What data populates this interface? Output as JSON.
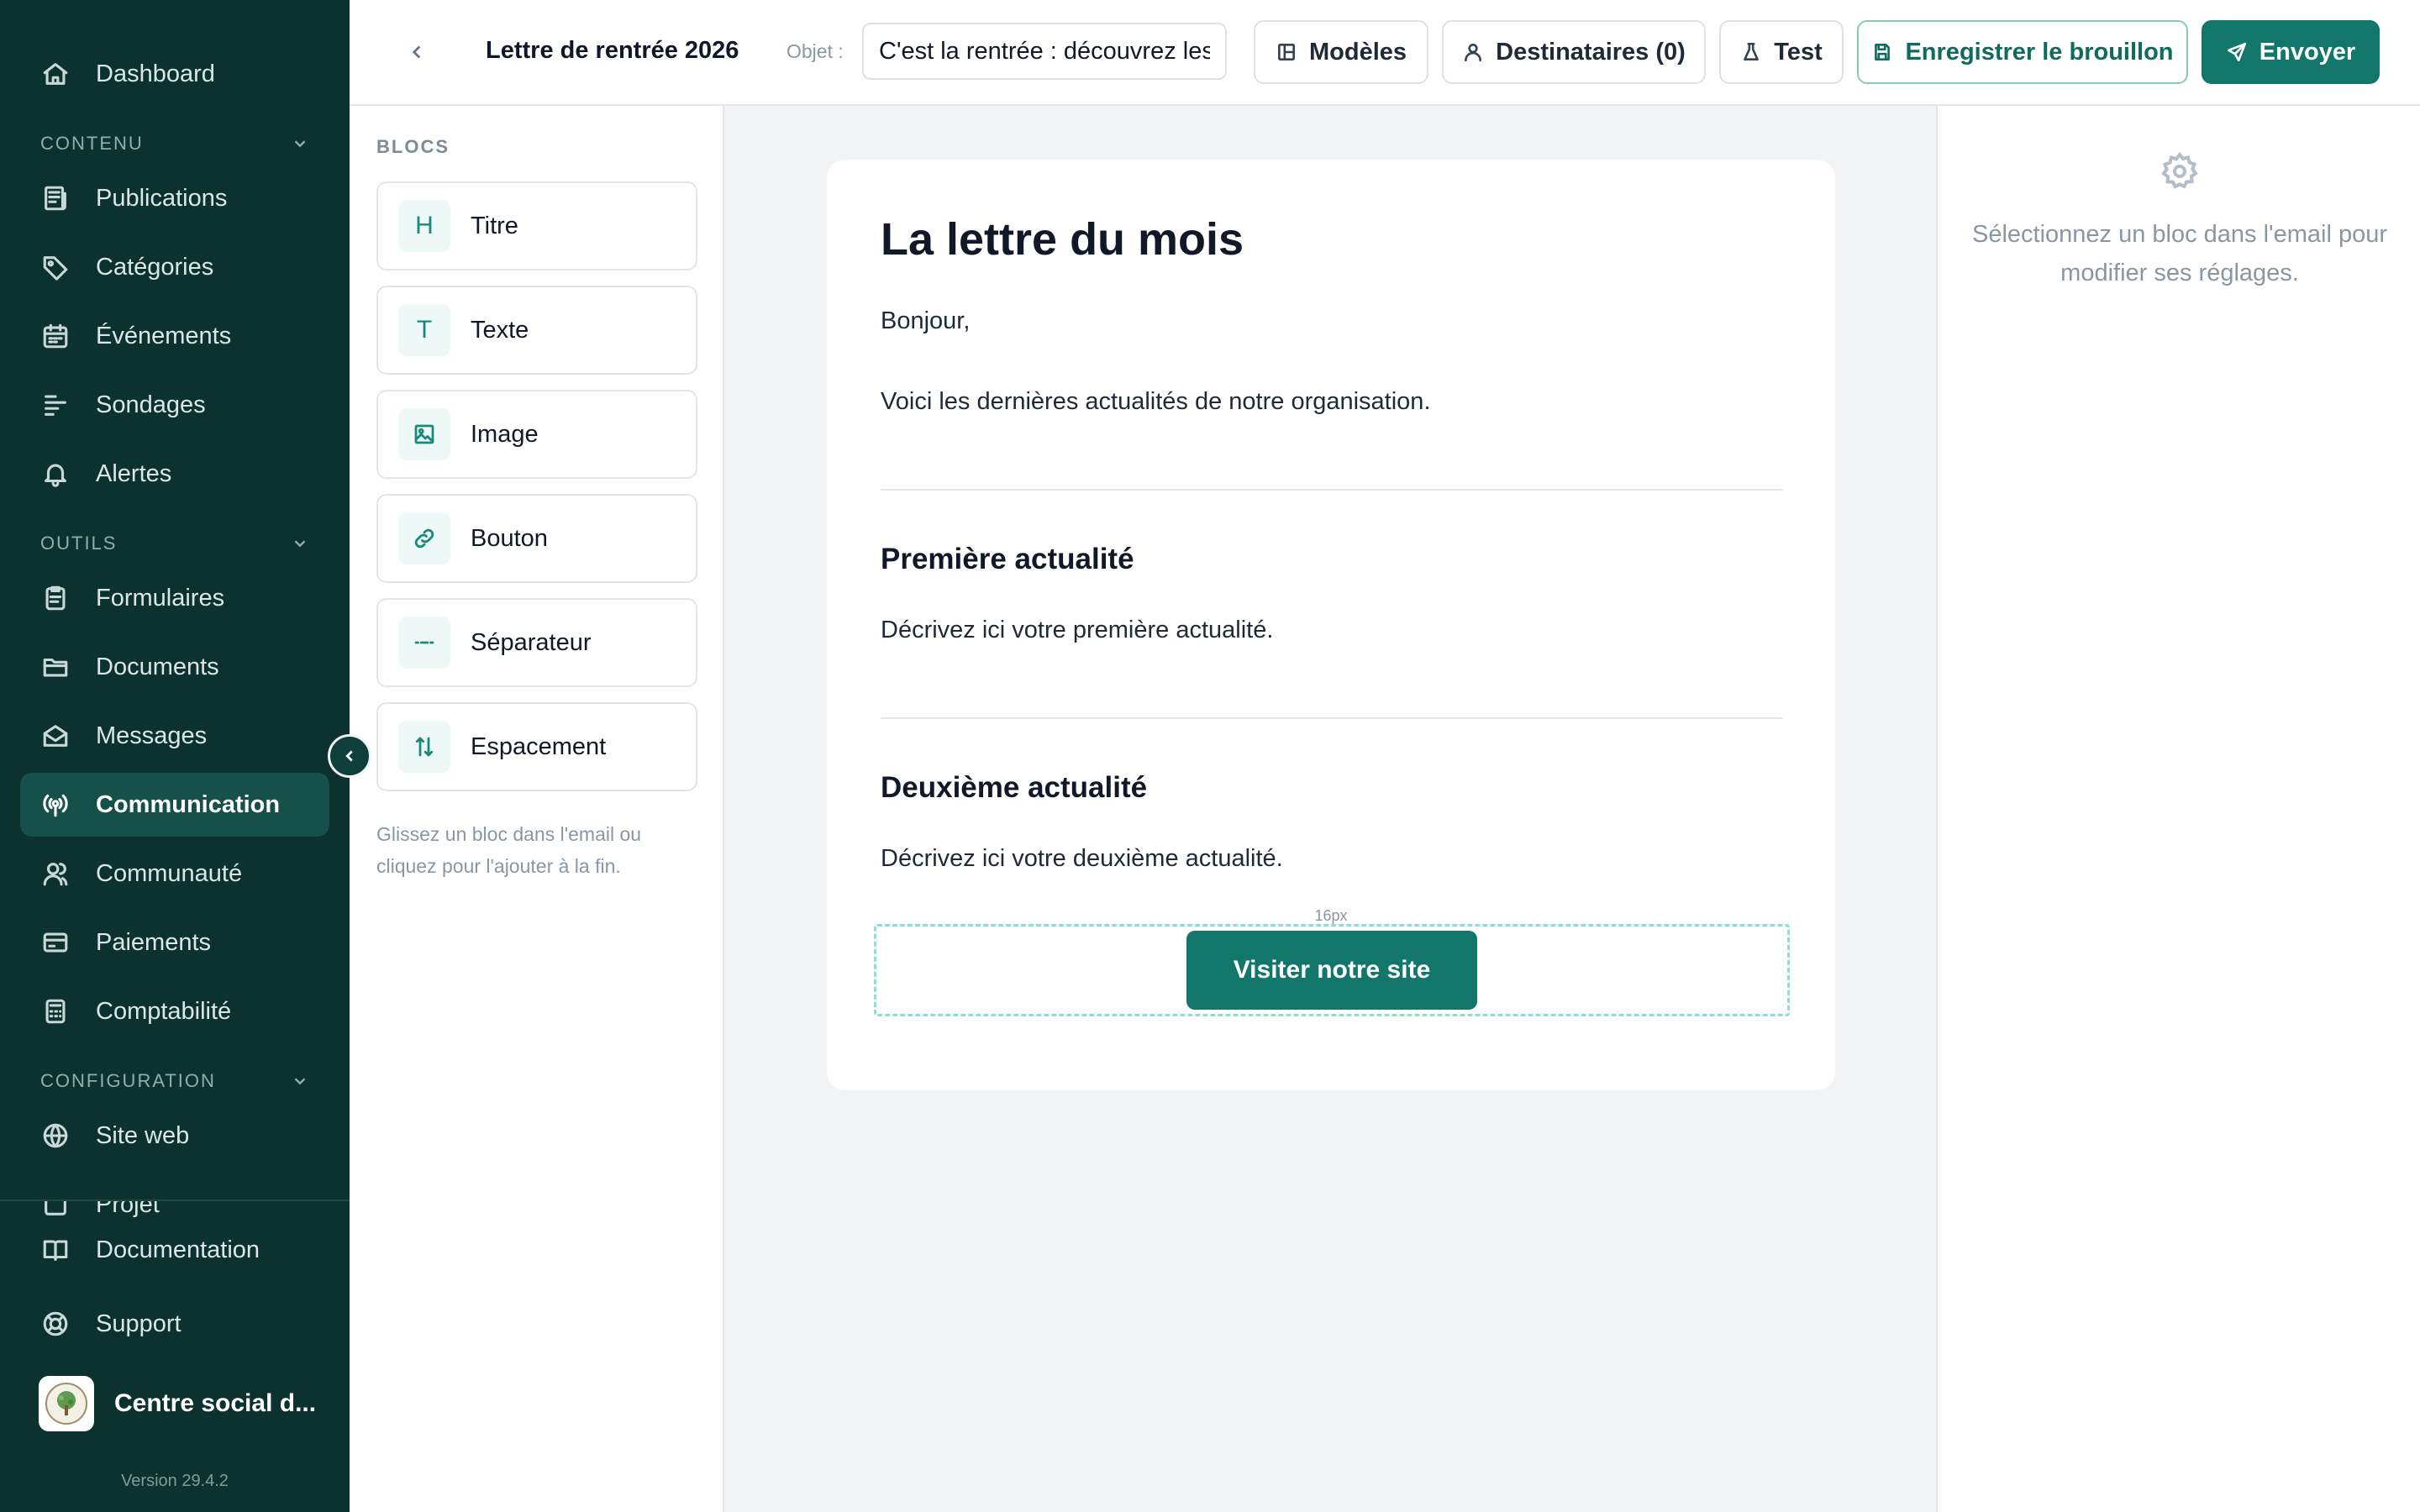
{
  "sidebar": {
    "items": [
      {
        "label": "Dashboard",
        "icon": "home-icon"
      },
      {
        "label": "Publications",
        "icon": "newspaper-icon"
      },
      {
        "label": "Catégories",
        "icon": "tag-icon"
      },
      {
        "label": "Événements",
        "icon": "calendar-icon"
      },
      {
        "label": "Sondages",
        "icon": "poll-icon"
      },
      {
        "label": "Alertes",
        "icon": "bell-icon"
      },
      {
        "label": "Formulaires",
        "icon": "clipboard-icon"
      },
      {
        "label": "Documents",
        "icon": "folder-icon"
      },
      {
        "label": "Messages",
        "icon": "mail-open-icon"
      },
      {
        "label": "Communication",
        "icon": "broadcast-icon"
      },
      {
        "label": "Communauté",
        "icon": "users-icon"
      },
      {
        "label": "Paiements",
        "icon": "wallet-icon"
      },
      {
        "label": "Comptabilité",
        "icon": "calculator-icon"
      },
      {
        "label": "Site web",
        "icon": "globe-icon"
      },
      {
        "label": "Projet",
        "icon": "project-icon"
      }
    ],
    "sections": {
      "contenu": "CONTENU",
      "outils": "OUTILS",
      "configuration": "CONFIGURATION"
    },
    "footer": {
      "documentation": "Documentation",
      "support": "Support",
      "org_name": "Centre social d...",
      "version": "Version 29.4.2"
    },
    "active_item": "Communication"
  },
  "topbar": {
    "title": "Lettre de rentrée 2026",
    "subject_label": "Objet :",
    "subject_value": "C'est la rentrée : découvrez les nouveautés",
    "templates_button": "Modèles",
    "recipients_button": "Destinataires (0)",
    "test_button": "Test",
    "save_draft_button": "Enregistrer le brouillon",
    "send_button": "Envoyer"
  },
  "blocks_panel": {
    "title": "BLOCS",
    "blocks": [
      {
        "label": "Titre",
        "icon": "heading-icon",
        "glyph": "H"
      },
      {
        "label": "Texte",
        "icon": "text-icon",
        "glyph": "T"
      },
      {
        "label": "Image",
        "icon": "image-icon"
      },
      {
        "label": "Bouton",
        "icon": "link-icon"
      },
      {
        "label": "Séparateur",
        "icon": "separator-icon"
      },
      {
        "label": "Espacement",
        "icon": "spacing-icon"
      }
    ],
    "hint": "Glissez un bloc dans l'email ou cliquez pour l'ajouter à la fin."
  },
  "email": {
    "heading": "La lettre du mois",
    "greeting": "Bonjour,",
    "intro": "Voici les dernières actualités de notre organisation.",
    "news1_title": "Première actualité",
    "news1_text": "Décrivez ici votre première actualité.",
    "news2_title": "Deuxième actualité",
    "news2_text": "Décrivez ici votre deuxième actualité.",
    "spacing_tag": "16px",
    "cta_label": "Visiter notre site"
  },
  "settings_panel": {
    "empty_text": "Sélectionnez un bloc dans l'email pour modifier ses réglages."
  },
  "colors": {
    "sidebar_bg": "#0c3230",
    "primary": "#12766a",
    "accent_dashed": "#8be0d2"
  }
}
